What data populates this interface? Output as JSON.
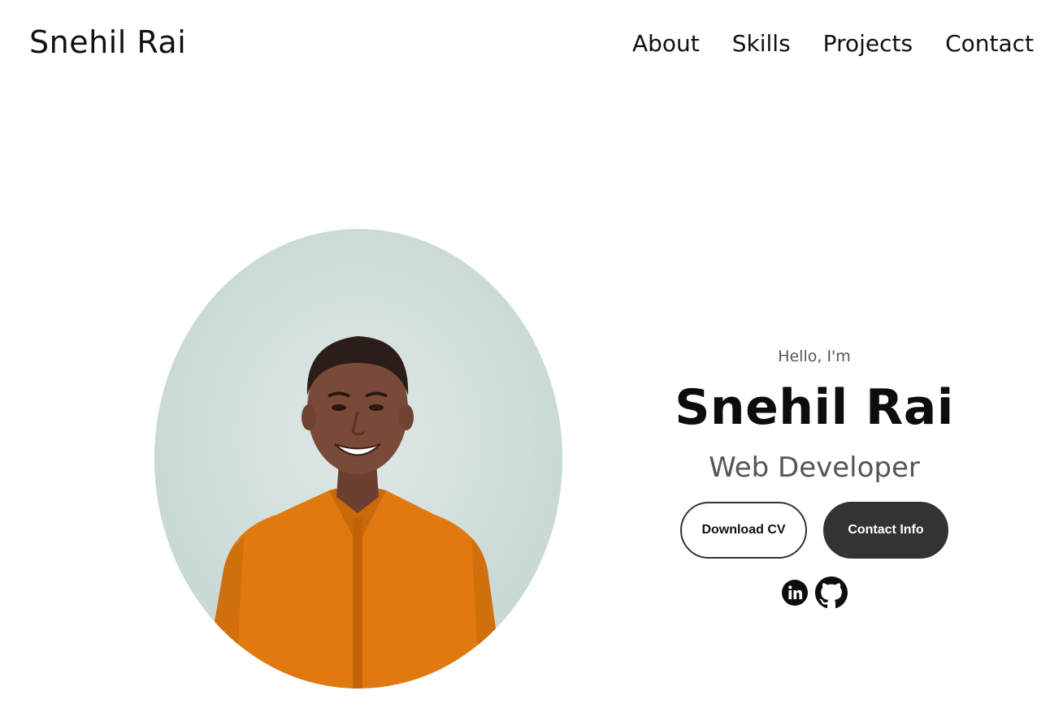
{
  "nav": {
    "logo": "Snehil Rai",
    "links": [
      "About",
      "Skills",
      "Projects",
      "Contact"
    ]
  },
  "profile": {
    "image_alt": "Profile picture",
    "background_color": "#c9d9d7",
    "shirt_color": "#e07a10"
  },
  "hero": {
    "greeting": "Hello, I'm",
    "name": "Snehil Rai",
    "role": "Web Developer",
    "download_cv_label": "Download CV",
    "contact_info_label": "Contact Info"
  },
  "socials": {
    "icons": [
      "linkedin-icon",
      "github-icon"
    ]
  }
}
